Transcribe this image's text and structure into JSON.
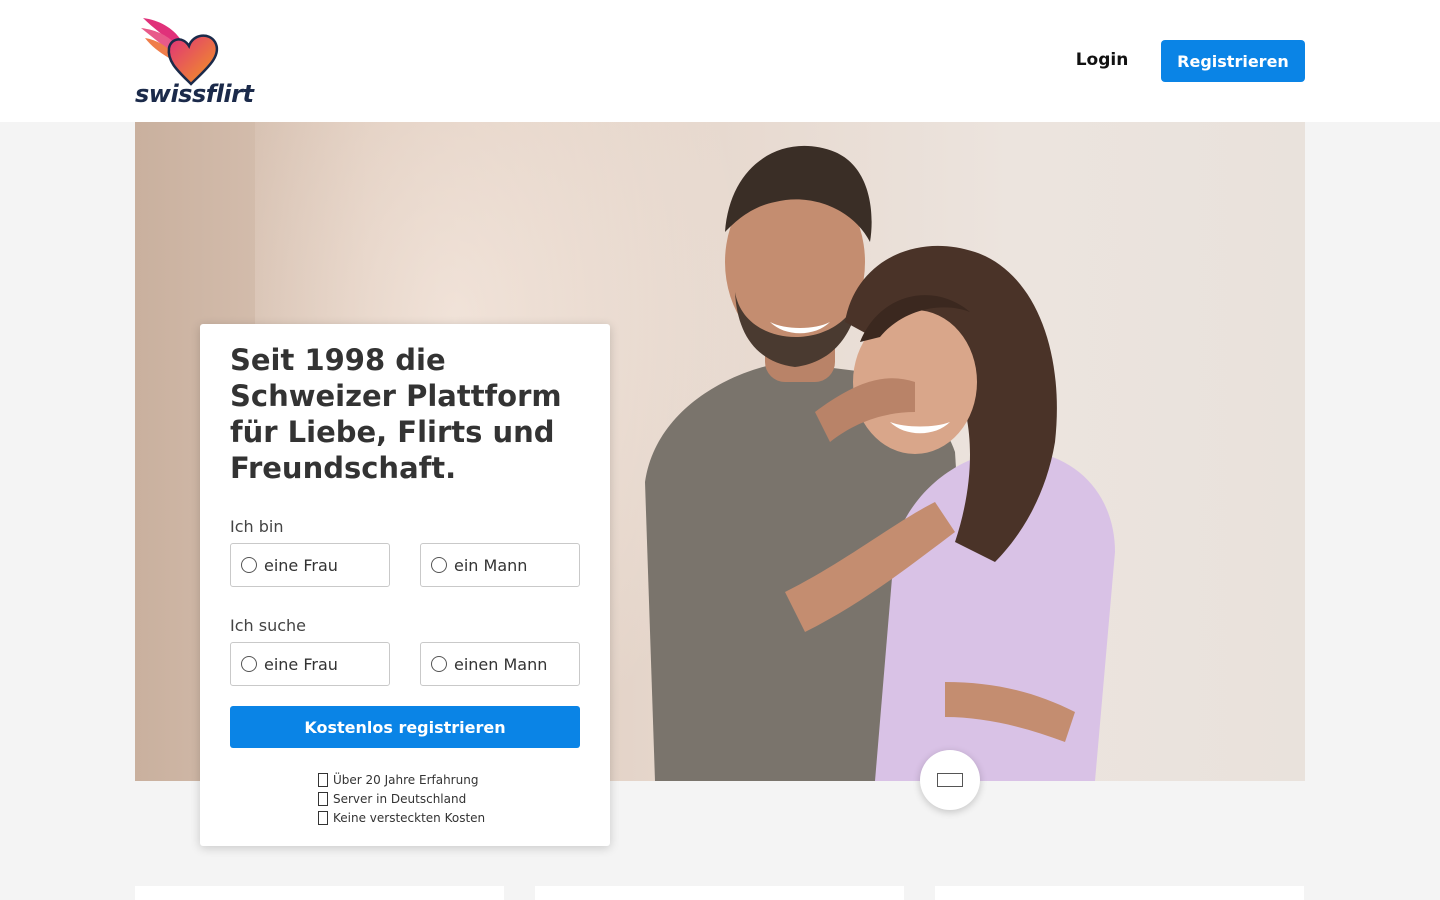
{
  "brand": {
    "name": "swissflirt"
  },
  "nav": {
    "login": "Login",
    "register": "Registrieren"
  },
  "form": {
    "title": "Seit 1998 die Schweizer Plattform für Liebe, Flirts und Freundschaft.",
    "i_am": {
      "label": "Ich bin",
      "options": [
        "eine Frau",
        "ein Mann"
      ]
    },
    "seeking": {
      "label": "Ich suche",
      "options": [
        "eine Frau",
        "einen Mann"
      ]
    },
    "cta": "Kostenlos registrieren",
    "features": [
      "Über 20 Jahre Erfahrung",
      "Server in Deutschland",
      "Keine versteckten Kosten"
    ]
  },
  "icons": {
    "logo": "winged-heart-icon",
    "scroll": "scroll-down-icon",
    "feature": "check-icon"
  },
  "colors": {
    "accent": "#0a84e6",
    "brand_text": "#1b2a4a",
    "logo_gradient_start": "#e0317a",
    "logo_gradient_end": "#f29a1f"
  }
}
